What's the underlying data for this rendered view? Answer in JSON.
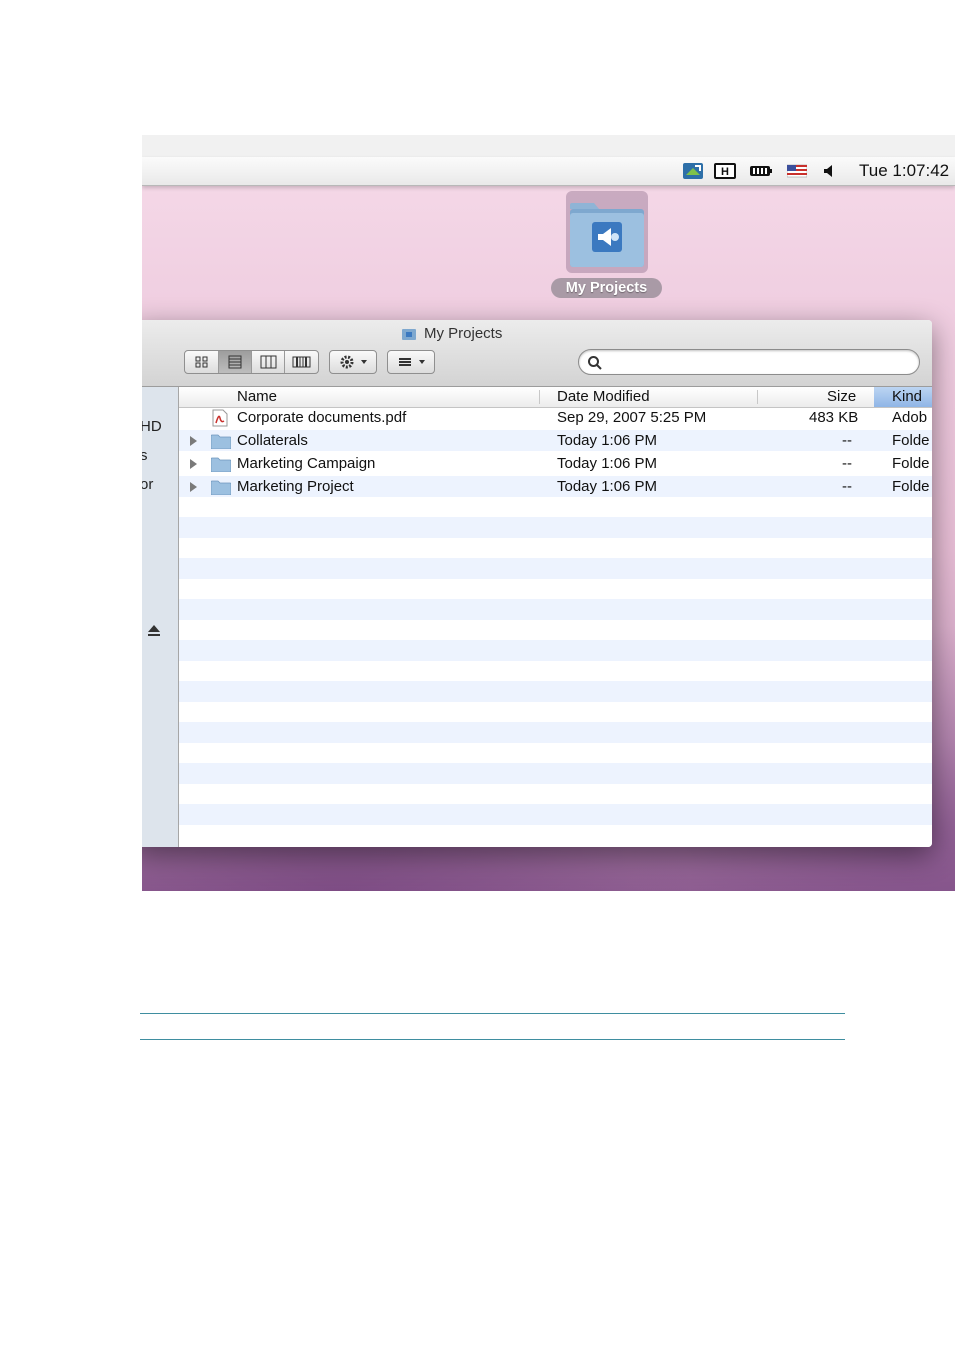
{
  "menubar": {
    "icons": [
      "network-status-icon",
      "input-method-icon",
      "battery-icon",
      "us-flag-icon",
      "volume-icon"
    ],
    "clock": "Tue 1:07:42"
  },
  "desktop": {
    "folder_label": "My Projects"
  },
  "window": {
    "title": "My Projects",
    "search": {
      "value": "",
      "placeholder": ""
    },
    "view_buttons": [
      "icon-view",
      "list-view",
      "column-view",
      "cover-flow-view"
    ],
    "sidebar": [
      "HD",
      "s",
      "or"
    ],
    "columns": {
      "name": "Name",
      "date": "Date Modified",
      "size": "Size",
      "kind": "Kind"
    },
    "rows": [
      {
        "name": "Corporate documents.pdf",
        "date": "Sep 29, 2007 5:25 PM",
        "size": "483 KB",
        "kind": "Adob",
        "icon": "pdf-icon",
        "expandable": false
      },
      {
        "name": "Collaterals",
        "date": "Today 1:06 PM",
        "size": "--",
        "kind": "Folde",
        "icon": "folder-icon",
        "expandable": true
      },
      {
        "name": "Marketing Campaign",
        "date": "Today 1:06 PM",
        "size": "--",
        "kind": "Folde",
        "icon": "folder-icon",
        "expandable": true
      },
      {
        "name": "Marketing Project",
        "date": "Today 1:06 PM",
        "size": "--",
        "kind": "Folde",
        "icon": "folder-icon",
        "expandable": true
      }
    ]
  },
  "colors": {
    "selected_header": "#8fb5e6",
    "stripe": "#edf3fe",
    "rule": "#3f8ea0"
  }
}
